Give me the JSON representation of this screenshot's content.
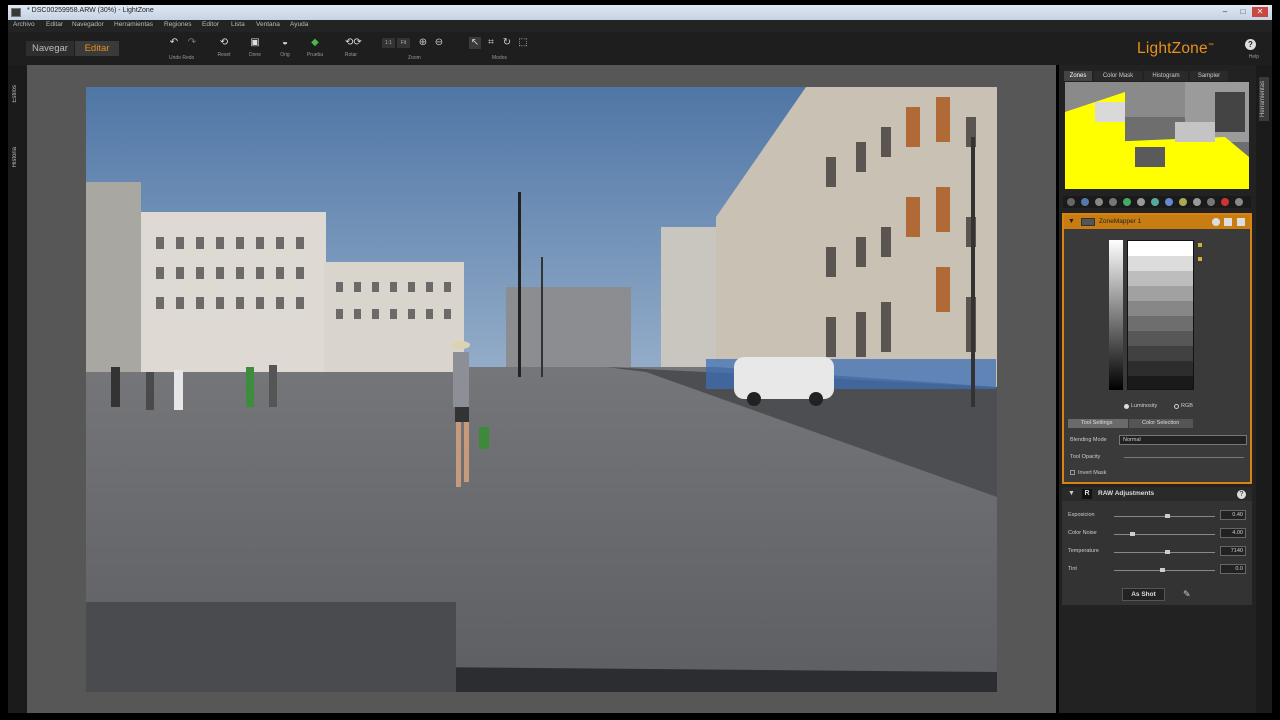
{
  "window": {
    "title": "* DSC00259958.ARW (30%) - LightZone",
    "min": "–",
    "max": "□",
    "close": "✕"
  },
  "menu": [
    "Archivo",
    "Editar",
    "Navegador",
    "Herramientas",
    "Regiones",
    "Editor",
    "Lista",
    "Ventana",
    "Ayuda"
  ],
  "toolbar": {
    "mode_browse": "Navegar",
    "mode_edit": "Editar",
    "undo_redo": "Undo Redo",
    "reset": "Reset",
    "done": "Done",
    "orig": "Orig",
    "proof": "Prueba",
    "rotate": "Rotar",
    "zoom_label": "Zoom",
    "zoom_fit": "1:1",
    "zoom_fit2": "Fit",
    "modes_label": "Modos",
    "brand": "LightZone",
    "tm": "™",
    "help_label": "Help"
  },
  "left_strip": {
    "tab1": "Estilos",
    "tab2": "Historia"
  },
  "right_strip": {
    "tab1": "Herramientas"
  },
  "panel": {
    "tabs": [
      "Zones",
      "Color Mask",
      "Histogram",
      "Sampler"
    ],
    "active_tab": "Zones"
  },
  "zonemapper": {
    "title": "ZoneMapper 1",
    "luminosity": "Luminosity",
    "rgb": "RGB",
    "subtab1": "Tool Settings",
    "subtab2": "Color Selection",
    "blending_label": "Blending Mode",
    "blending_value": "Normal",
    "opacity_label": "Tool Opacity",
    "invert_label": "Invert Mask"
  },
  "raw": {
    "title": "RAW Adjustments",
    "rows": [
      {
        "label": "Exposicion",
        "value": "0.40",
        "level": 0.52
      },
      {
        "label": "Color Noise",
        "value": "4.00",
        "level": 0.18
      },
      {
        "label": "Temperature",
        "value": "7140",
        "level": 0.52
      },
      {
        "label": "Tint",
        "value": "0.0",
        "level": 0.48
      }
    ],
    "asshot": "As Shot"
  },
  "colors": {
    "accent": "#e8911d",
    "panel_border": "#d98412"
  }
}
